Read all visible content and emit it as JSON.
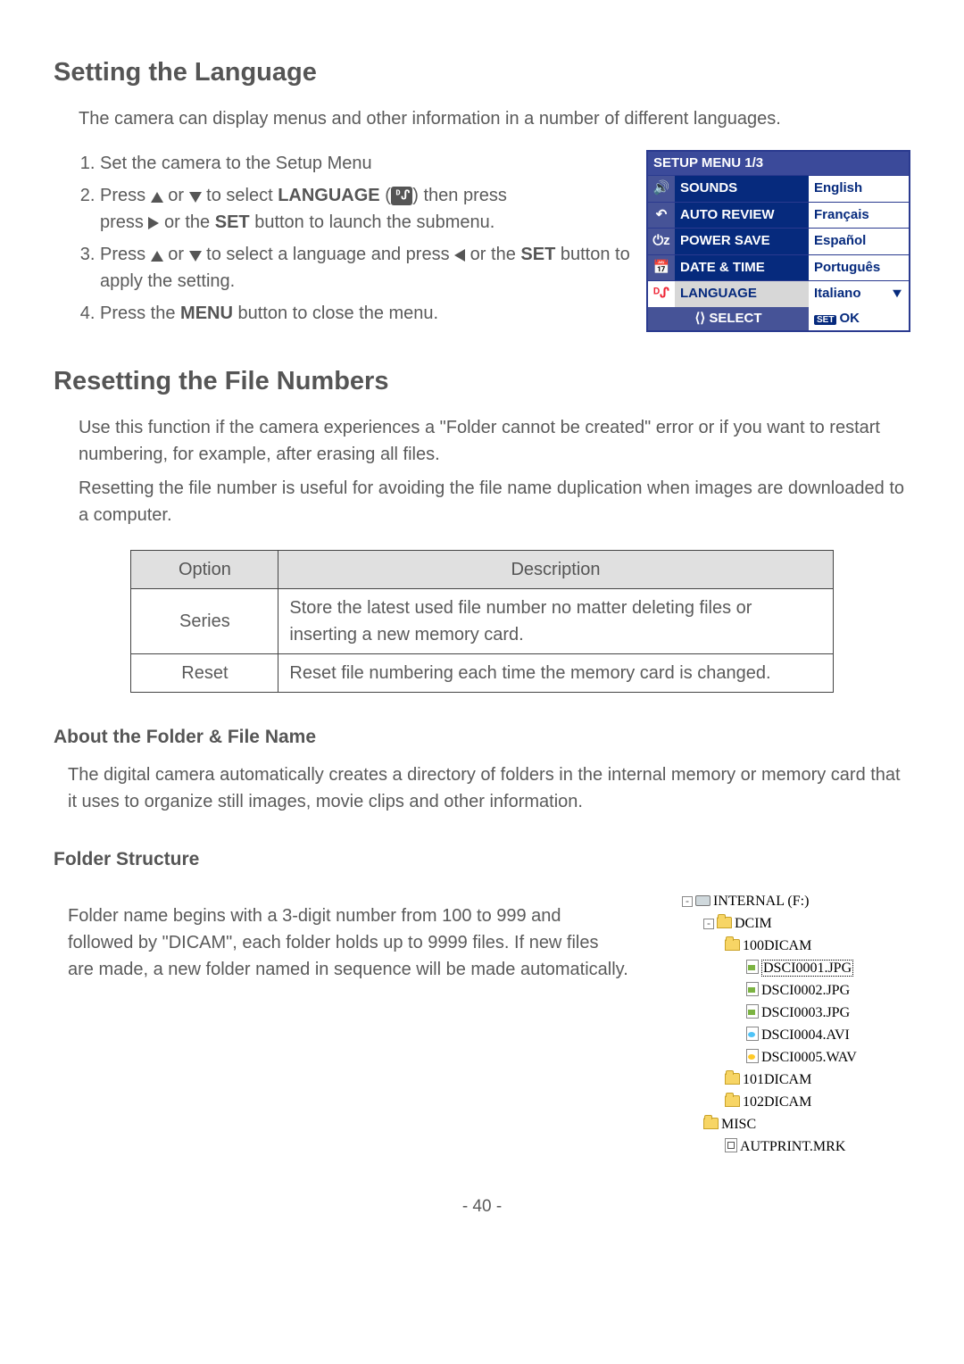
{
  "section1": {
    "heading": "Setting the Language",
    "intro": "The camera can display menus and other information in a number of different languages.",
    "steps": {
      "s1": "Set the camera to the Setup Menu",
      "s2a": "Press ",
      "s2b": " or ",
      "s2c": " to select ",
      "s2_lang": "LANGUAGE",
      "s2d": " (",
      "s2e": ") then press ",
      "s2f": " or the ",
      "s2_set": "SET",
      "s2g": " button to launch the submenu.",
      "s3a": "Press ",
      "s3b": " or ",
      "s3c": " to select a language and press ",
      "s3d": " or the ",
      "s3_set": "SET",
      "s3e": " button to apply the setting.",
      "s4a": "Press the ",
      "s4_menu": "MENU",
      "s4b": " button to close the menu."
    }
  },
  "setup_menu": {
    "title": "SETUP MENU 1/3",
    "rows": [
      {
        "icon": "🔊",
        "name": "SOUNDS",
        "val": "English"
      },
      {
        "icon": "↶",
        "name": "AUTO REVIEW",
        "val": "Français"
      },
      {
        "icon": "⏻z",
        "name": "POWER SAVE",
        "val": "Español"
      },
      {
        "icon": "📅",
        "name": "DATE & TIME",
        "val": "Português"
      },
      {
        "icon": "ᴰᔑ",
        "name": "LANGUAGE",
        "val": "Italiano",
        "sel": true
      }
    ],
    "footer_left": "⟨⟩ SELECT",
    "footer_set": "SET",
    "footer_ok": "OK"
  },
  "section2": {
    "heading": "Resetting the File Numbers",
    "p1": "Use this function if the camera experiences a \"Folder cannot be created\" error or if you want to restart numbering, for example, after erasing all files.",
    "p2": "Resetting the file number is useful for avoiding the file name duplication when images are downloaded to a computer.",
    "table": {
      "h1": "Option",
      "h2": "Description",
      "r1o": "Series",
      "r1d": "Store the latest used file number no matter deleting files or inserting a new memory card.",
      "r2o": "Reset",
      "r2d": "Reset file numbering each time the memory card is changed."
    }
  },
  "folder": {
    "heading": "About the Folder & File Name",
    "p": "The digital camera automatically creates a directory of folders in the internal memory or memory card that it uses to organize still images, movie clips and other information."
  },
  "structure": {
    "heading": "Folder Structure",
    "p": "Folder name begins with a 3-digit number from 100 to 999 and followed by \"DICAM\", each folder holds up to 9999 files.   If new files are made, a new folder named in sequence will be made automatically."
  },
  "tree": {
    "drive": "INTERNAL (F:)",
    "dcim": "DCIM",
    "f100": "100DICAM",
    "files": [
      "DSCI0001.JPG",
      "DSCI0002.JPG",
      "DSCI0003.JPG",
      "DSCI0004.AVI",
      "DSCI0005.WAV"
    ],
    "f101": "101DICAM",
    "f102": "102DICAM",
    "misc": "MISC",
    "aut": "AUTPRINT.MRK"
  },
  "pagenum": "- 40 -"
}
